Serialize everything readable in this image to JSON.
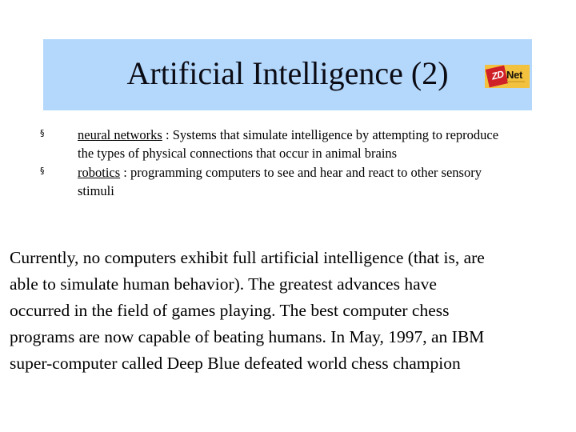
{
  "slide": {
    "title": "Artificial Intelligence (2)",
    "banner_color": "#b4d8fc",
    "background_color": "#ffffff",
    "text_color": "#000000"
  },
  "logo": {
    "name": "zdnet-logo",
    "mark_text": "ZD",
    "word_text": "Net",
    "plate_color": "#f2c23e",
    "diamond_color": "#cf2027",
    "word_color": "#17110a"
  },
  "bullets": [
    {
      "marker": "§",
      "term": "neural networks",
      "separator": " : ",
      "definition": "Systems that simulate intelligence by attempting to reproduce the types of physical connections that occur in animal brains"
    },
    {
      "marker": "§",
      "term": "robotics",
      "separator": " : ",
      "definition": "programming computers to see and hear and react to other sensory stimuli"
    }
  ],
  "body": {
    "lines": [
      "Currently, no computers exhibit full artificial intelligence (that is, are",
      "able to simulate human behavior). The greatest advances have",
      "occurred in the field of games playing. The best computer chess",
      "programs are now capable of beating humans. In May, 1997, an IBM",
      "super-computer called Deep Blue defeated world chess champion"
    ],
    "full_text": "Currently, no computers exhibit full artificial intelligence (that is, are able to simulate human behavior). The greatest advances have occurred in the field of games playing. The best computer chess programs are now capable of beating humans. In May, 1997, an IBM super-computer called Deep Blue defeated world chess champion"
  }
}
